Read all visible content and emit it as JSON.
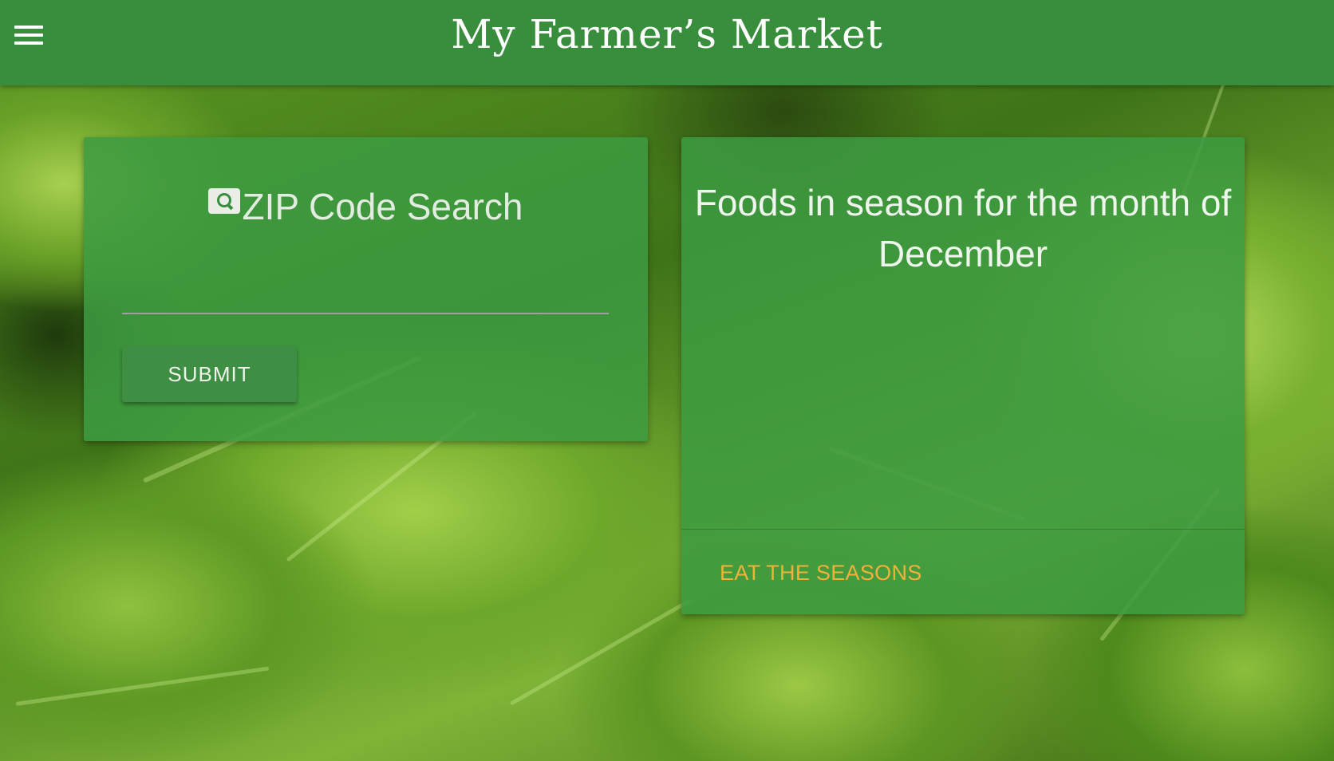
{
  "header": {
    "title": "My Farmer’s Market",
    "menu_icon": "hamburger-menu-icon"
  },
  "search_card": {
    "heading": "ZIP Code Search",
    "icon": "search-icon",
    "input_value": "",
    "input_placeholder": "",
    "submit_label": "SUBMIT"
  },
  "season_card": {
    "title": "Foods in season for the month of December",
    "link_label": "EAT THE SEASONS",
    "link_color": "#f0b23a"
  },
  "colors": {
    "header_bg": "#388e3c",
    "card_bg": "#3c9b41"
  }
}
